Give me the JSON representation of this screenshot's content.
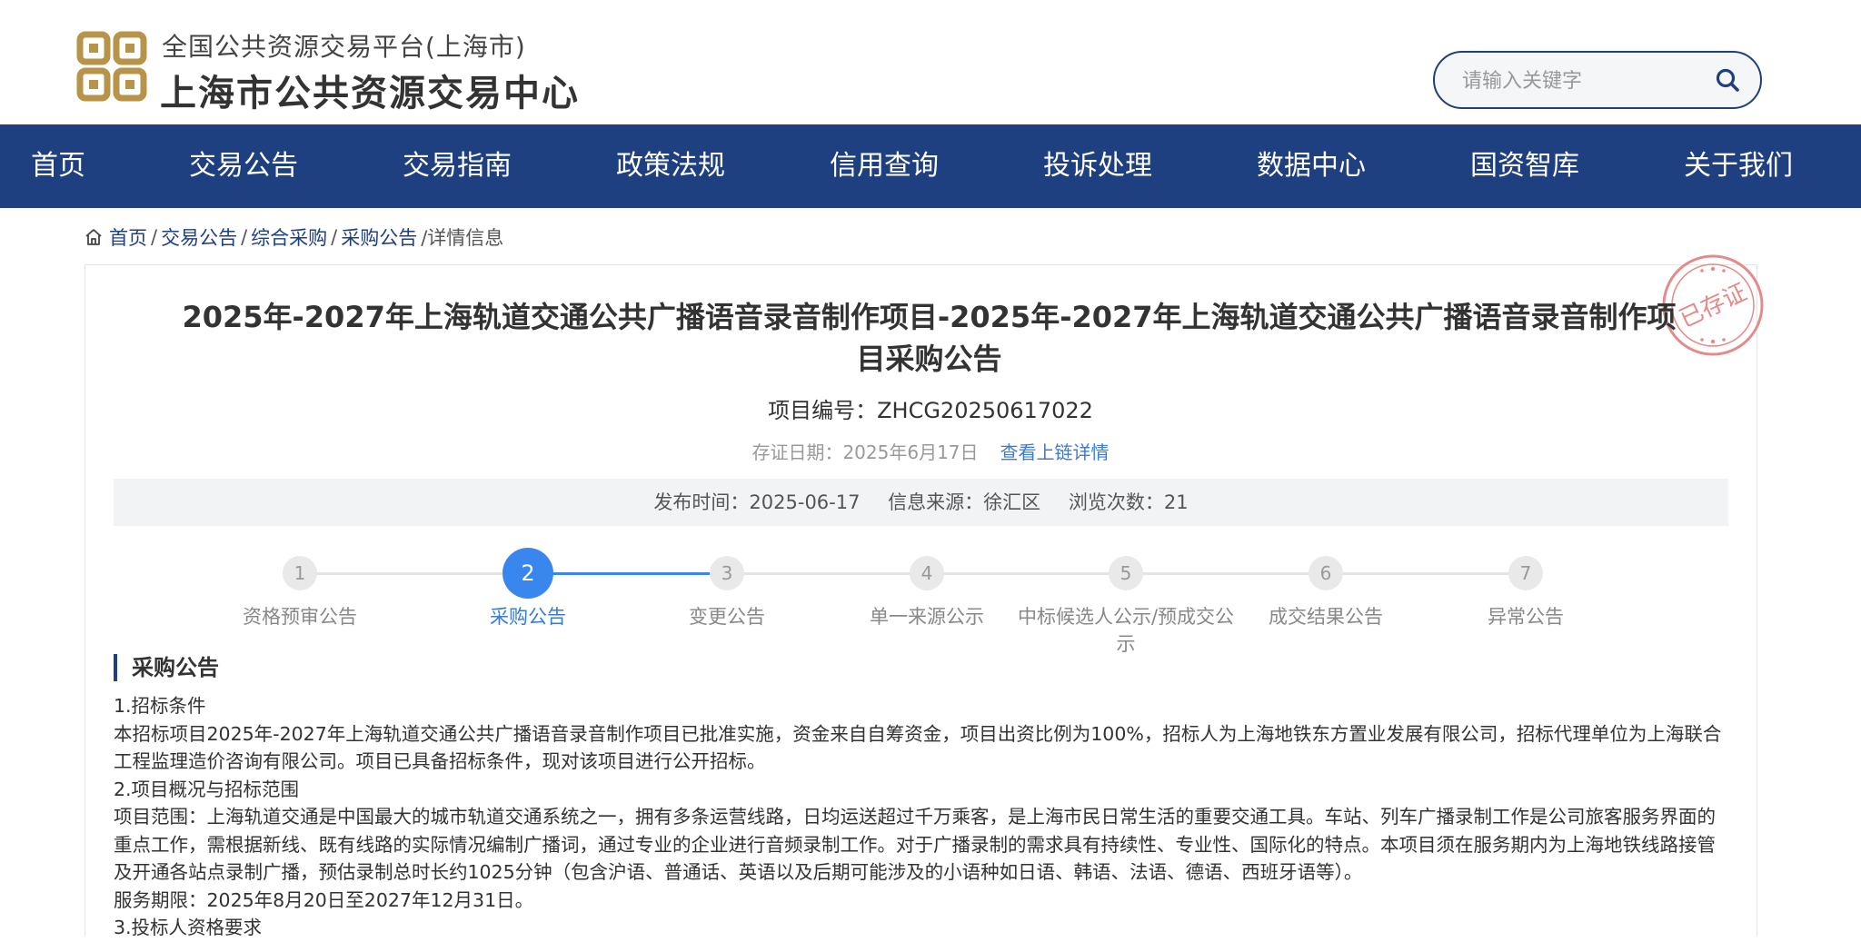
{
  "header": {
    "subtitle": "全国公共资源交易平台(上海市)",
    "title": "上海市公共资源交易中心",
    "search_placeholder": "请输入关键字"
  },
  "nav": [
    "首页",
    "交易公告",
    "交易指南",
    "政策法规",
    "信用查询",
    "投诉处理",
    "数据中心",
    "国资智库",
    "关于我们"
  ],
  "breadcrumb": {
    "items": [
      "首页",
      "交易公告",
      "综合采购",
      "采购公告"
    ],
    "current": "/详情信息"
  },
  "seal_text": "已存证",
  "article": {
    "title": "2025年-2027年上海轨道交通公共广播语音录音制作项目-2025年-2027年上海轨道交通公共广播语音录音制作项目采购公告",
    "project_no": "项目编号：ZHCG20250617022",
    "cert_date": "存证日期：2025年6月17日",
    "cert_link": "查看上链详情",
    "publish_time": "发布时间：2025-06-17",
    "source": "信息来源：徐汇区",
    "views": "浏览次数：21"
  },
  "steps": [
    {
      "num": "1",
      "label": "资格预审公告",
      "active": false
    },
    {
      "num": "2",
      "label": "采购公告",
      "active": true
    },
    {
      "num": "3",
      "label": "变更公告",
      "active": false
    },
    {
      "num": "4",
      "label": "单一来源公示",
      "active": false
    },
    {
      "num": "5",
      "label": "中标候选人公示/预成交公示",
      "active": false
    },
    {
      "num": "6",
      "label": "成交结果公告",
      "active": false
    },
    {
      "num": "7",
      "label": "异常公告",
      "active": false
    }
  ],
  "section": {
    "title": "采购公告",
    "paragraphs": [
      "1.招标条件",
      "本招标项目2025年-2027年上海轨道交通公共广播语音录音制作项目已批准实施，资金来自自筹资金，项目出资比例为100%，招标人为上海地铁东方置业发展有限公司，招标代理单位为上海联合工程监理造价咨询有限公司。项目已具备招标条件，现对该项目进行公开招标。",
      "2.项目概况与招标范围",
      "项目范围：上海轨道交通是中国最大的城市轨道交通系统之一，拥有多条运营线路，日均运送超过千万乘客，是上海市民日常生活的重要交通工具。车站、列车广播录制工作是公司旅客服务界面的重点工作，需根据新线、既有线路的实际情况编制广播词，通过专业的企业进行音频录制工作。对于广播录制的需求具有持续性、专业性、国际化的特点。本项目须在服务期内为上海地铁线路接管及开通各站点录制广播，预估录制总时长约1025分钟（包含沪语、普通话、英语以及后期可能涉及的小语种如日语、韩语、法语、德语、西班牙语等）。",
      "服务期限：2025年8月20日至2027年12月31日。",
      "3.投标人资格要求"
    ]
  }
}
